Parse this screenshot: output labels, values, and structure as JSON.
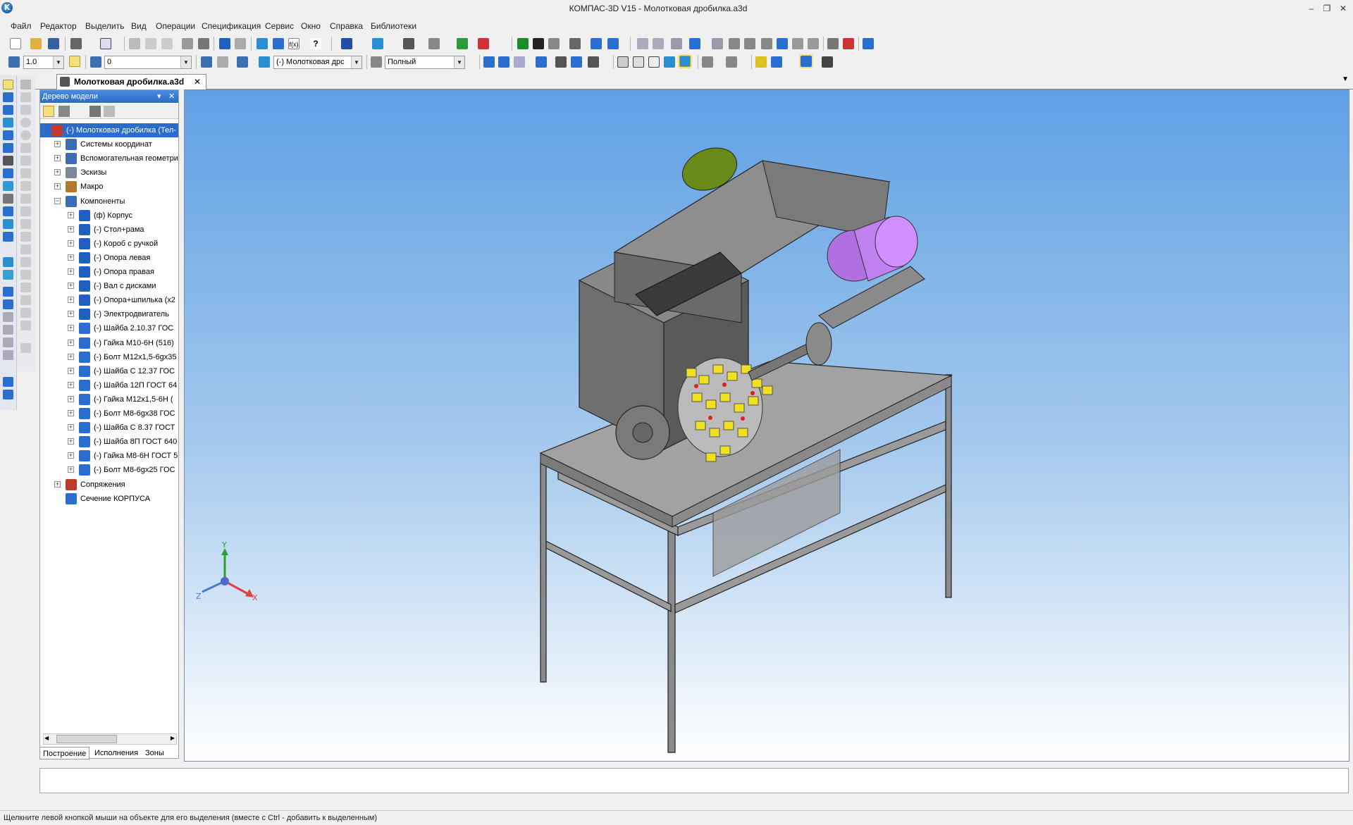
{
  "window": {
    "title": "КОМПАС-3D V15 - Молотковая дробилка.a3d",
    "logo": "kompas-logo",
    "minimize": "‒",
    "restore": "❐",
    "close": "✕"
  },
  "menu": [
    "Файл",
    "Редактор",
    "Выделить",
    "Вид",
    "Операции",
    "Спецификация",
    "Сервис",
    "Окно",
    "Справка",
    "Библиотеки"
  ],
  "toolbar2": {
    "step_value": "1.0",
    "layer_value": "0",
    "component_value": "(-) Молотковая дрс",
    "view_mode_value": "Полный"
  },
  "doc_tab": {
    "title": "Молотковая дробилка.a3d",
    "close": "✕"
  },
  "tree_panel": {
    "title": "Дерево модели",
    "pin": "▾",
    "close": "✕",
    "items": [
      {
        "label": "(-) Молотковая дробилка (Тел-",
        "level": 0,
        "expander": "",
        "icon": "assembly-root",
        "color": "#c0392b"
      },
      {
        "label": "Системы координат",
        "level": 1,
        "expander": "+",
        "icon": "coordinate-systems",
        "color": "#3b6db5"
      },
      {
        "label": "Вспомогательная геометри",
        "level": 1,
        "expander": "+",
        "icon": "auxiliary-geometry",
        "color": "#3b6db5"
      },
      {
        "label": "Эскизы",
        "level": 1,
        "expander": "+",
        "icon": "sketches",
        "color": "#7a8a9a"
      },
      {
        "label": "Макро",
        "level": 1,
        "expander": "+",
        "icon": "macro",
        "color": "#b07a2a"
      },
      {
        "label": "Компоненты",
        "level": 1,
        "expander": "−",
        "icon": "components",
        "color": "#3b6db5"
      },
      {
        "label": "(ф) Корпус",
        "level": 2,
        "expander": "+",
        "icon": "part",
        "color": "#1e5fbf"
      },
      {
        "label": "(-) Стол+рама",
        "level": 2,
        "expander": "+",
        "icon": "part",
        "color": "#1e5fbf"
      },
      {
        "label": "(-) Короб с ручкой",
        "level": 2,
        "expander": "+",
        "icon": "part",
        "color": "#1e5fbf"
      },
      {
        "label": "(-) Опора левая",
        "level": 2,
        "expander": "+",
        "icon": "part",
        "color": "#1e5fbf"
      },
      {
        "label": "(-) Опора правая",
        "level": 2,
        "expander": "+",
        "icon": "part",
        "color": "#1e5fbf"
      },
      {
        "label": "(-) Вал с дисками",
        "level": 2,
        "expander": "+",
        "icon": "part",
        "color": "#1e5fbf"
      },
      {
        "label": "(-) Опора+шпилька (x2",
        "level": 2,
        "expander": "+",
        "icon": "part",
        "color": "#1e5fbf"
      },
      {
        "label": "(-) Электродвигатель",
        "level": 2,
        "expander": "+",
        "icon": "part",
        "color": "#1e5fbf"
      },
      {
        "label": "(-) Шайба 2.10.37 ГОС",
        "level": 2,
        "expander": "+",
        "icon": "standard-part",
        "color": "#2a6fd0"
      },
      {
        "label": "(-) Гайка М10-6Н (516)",
        "level": 2,
        "expander": "+",
        "icon": "standard-part",
        "color": "#2a6fd0"
      },
      {
        "label": "(-) Болт М12х1,5-6gx35",
        "level": 2,
        "expander": "+",
        "icon": "standard-part",
        "color": "#2a6fd0"
      },
      {
        "label": "(-) Шайба С 12.37 ГОС",
        "level": 2,
        "expander": "+",
        "icon": "standard-part",
        "color": "#2a6fd0"
      },
      {
        "label": "(-) Шайба 12П ГОСТ 64",
        "level": 2,
        "expander": "+",
        "icon": "standard-part",
        "color": "#2a6fd0"
      },
      {
        "label": "(-) Гайка М12х1,5-6Н (",
        "level": 2,
        "expander": "+",
        "icon": "standard-part",
        "color": "#2a6fd0"
      },
      {
        "label": "(-) Болт М8-6gx38 ГОС",
        "level": 2,
        "expander": "+",
        "icon": "standard-part",
        "color": "#2a6fd0"
      },
      {
        "label": "(-) Шайба С 8.37 ГОСТ",
        "level": 2,
        "expander": "+",
        "icon": "standard-part",
        "color": "#2a6fd0"
      },
      {
        "label": "(-) Шайба 8П ГОСТ 640",
        "level": 2,
        "expander": "+",
        "icon": "standard-part",
        "color": "#2a6fd0"
      },
      {
        "label": "(-) Гайка М8-6Н ГОСТ 5",
        "level": 2,
        "expander": "+",
        "icon": "standard-part",
        "color": "#2a6fd0"
      },
      {
        "label": "(-) Болт М8-6gx25 ГОС",
        "level": 2,
        "expander": "+",
        "icon": "standard-part",
        "color": "#2a6fd0"
      },
      {
        "label": "Сопряжения",
        "level": 1,
        "expander": "+",
        "icon": "mates",
        "color": "#c0392b"
      },
      {
        "label": "Сечение КОРПУСА",
        "level": 1,
        "expander": "",
        "icon": "section",
        "color": "#2a6fd0"
      }
    ],
    "tabs": [
      "Построение",
      "Исполнения",
      "Зоны"
    ]
  },
  "viewport": {
    "axis_x": "X",
    "axis_y": "Y",
    "axis_z": "Z",
    "bg_top": "#5fa0e4",
    "bg_bottom": "#ffffff"
  },
  "status": {
    "hint": "Щелкните левой кнопкой мыши на объекте для его выделения (вместе с Ctrl - добавить к выделенным)"
  }
}
